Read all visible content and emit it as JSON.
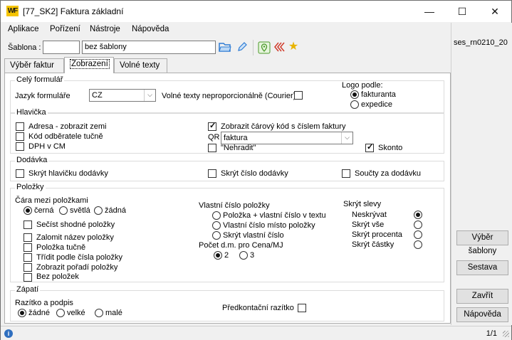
{
  "window": {
    "title": "[77_SK2] Faktura základní",
    "logo": "WF"
  },
  "menu": [
    "Aplikace",
    "Pořízení",
    "Nástroje",
    "Nápověda"
  ],
  "toolbar": {
    "sablona_label": "Šablona :",
    "sablona_value": "",
    "sablona_name": "bez šablony"
  },
  "tabs": [
    "Výběr faktur",
    "Zobrazení",
    "Volné texty"
  ],
  "right_panel": {
    "text": "ses_rn0210_20",
    "btn_vyber": "Výběr šablony",
    "btn_sestava": "Sestava",
    "btn_zavrit": "Zavřít",
    "btn_napoveda": "Nápověda"
  },
  "status": {
    "pages": "1/1"
  },
  "g1": {
    "title": "Celý formulář",
    "jazyk_label": "Jazyk formuláře",
    "jazyk_value": "CZ",
    "volne_label": "Volné texty neproporcionálně (Courier)",
    "logo_label": "Logo podle:",
    "logo_opt1": "fakturanta",
    "logo_opt2": "expedice"
  },
  "g2": {
    "title": "Hlavička",
    "c1": "Adresa - zobrazit zemi",
    "c2": "Kód odběratele tučně",
    "c3": "DPH v CM",
    "c4": "Zobrazit čárový kód s číslem faktury",
    "qr_label": "QR",
    "qr_value": "faktura",
    "c5": "\"Nehradit\"",
    "c6": "Skonto"
  },
  "g3": {
    "title": "Dodávka",
    "c1": "Skrýt hlavičku dodávky",
    "c2": "Skrýt číslo dodávky",
    "c3": "Součty za dodávku"
  },
  "g4": {
    "title": "Položky",
    "cara_label": "Čára mezi položkami",
    "cara_o1": "černá",
    "cara_o2": "světlá",
    "cara_o3": "žádná",
    "p1": "Sečíst shodné položky",
    "p2": "Zalomit název položky",
    "p3": "Položka tučně",
    "p4": "Třídit podle čísla položky",
    "p5": "Zobrazit pořadí položky",
    "p6": "Bez položek",
    "vl_label": "Vlastní číslo položky",
    "vl_o1": "Položka + vlastní číslo v textu",
    "vl_o2": "Vlastní číslo místo položky",
    "vl_o3": "Skrýt vlastní číslo",
    "pocet_label": "Počet d.m. pro Cena/MJ",
    "pocet_o1": "2",
    "pocet_o2": "3",
    "sl_label": "Skrýt slevy",
    "sl_o1": "Neskrývat",
    "sl_o2": "Skrýt vše",
    "sl_o3": "Skrýt procenta",
    "sl_o4": "Skrýt částky"
  },
  "g5": {
    "title": "Zápatí",
    "raz_label": "Razítko a podpis",
    "raz_o1": "žádné",
    "raz_o2": "velké",
    "raz_o3": "malé",
    "pred_label": "Předkontační razítko"
  }
}
